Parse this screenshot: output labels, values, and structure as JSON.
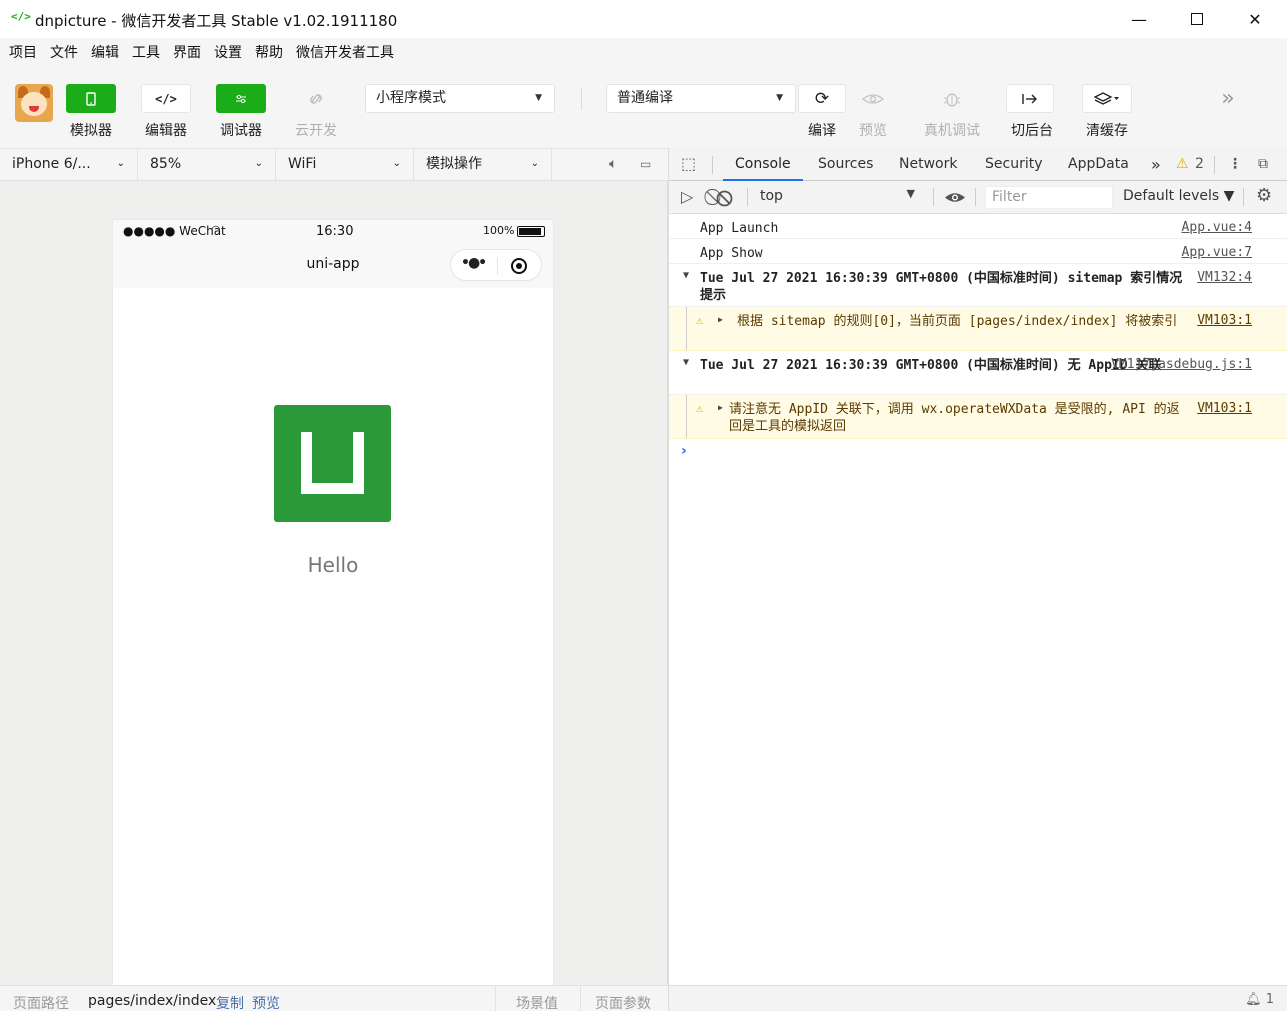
{
  "window": {
    "title": "dnpicture - 微信开发者工具 Stable v1.02.1911180",
    "logo_glyph": "</>",
    "min": "—",
    "close": "✕"
  },
  "menu": [
    "项目",
    "文件",
    "编辑",
    "工具",
    "界面",
    "设置",
    "帮助",
    "微信开发者工具"
  ],
  "toolbar": {
    "simulator": "模拟器",
    "editor": "编辑器",
    "debugger": "调试器",
    "cloud": "云开发",
    "mode_select": "小程序模式",
    "compile_select": "普通编译",
    "compile": "编译",
    "preview": "预览",
    "remote_debug": "真机调试",
    "background": "切后台",
    "clear_cache": "清缓存"
  },
  "simbar": {
    "device": "iPhone 6/...",
    "zoom": "85%",
    "network": "WiFi",
    "operation": "模拟操作"
  },
  "phone": {
    "signal": "●●●●● WeChat",
    "time": "16:30",
    "battery": "100%",
    "nav_title": "uni-app",
    "content_text": "Hello"
  },
  "simfooter": {
    "path_label": "页面路径",
    "path": "pages/index/index",
    "copy": "复制",
    "preview": "预览",
    "scene": "场景值",
    "params": "页面参数"
  },
  "devtools": {
    "tabs": [
      "Console",
      "Sources",
      "Network",
      "Security",
      "AppData"
    ],
    "more": "»",
    "warn_count": "2",
    "context": "top",
    "filter_placeholder": "Filter",
    "levels": "Default levels ▼",
    "footer_count": "1",
    "prompt": "›"
  },
  "console": [
    {
      "msg": "App Launch",
      "src": "App.vue:4"
    },
    {
      "msg": "App Show",
      "src": "App.vue:7"
    },
    {
      "msg": "Tue Jul 27 2021 16:30:39 GMT+0800 (中国标准时间) sitemap 索引情况提示",
      "src": "VM132:4"
    },
    {
      "msg": "根据 sitemap 的规则[0]，当前页面 [pages/index/index] 将被索引",
      "src": "VM103:1"
    },
    {
      "msg": "Tue Jul 27 2021 16:30:39 GMT+0800 (中国标准时间) 无 AppID 关联",
      "src": "VM117 asdebug.js:1"
    },
    {
      "msg": "请注意无 AppID 关联下，调用 wx.operateWXData 是受限的, API 的返回是工具的模拟返回",
      "src": "VM103:1"
    }
  ],
  "colors": {
    "accent_green": "#1aad19",
    "uni_green": "#2b9939",
    "link_blue": "#1a73e8",
    "warn_bg": "#fffbe5"
  }
}
